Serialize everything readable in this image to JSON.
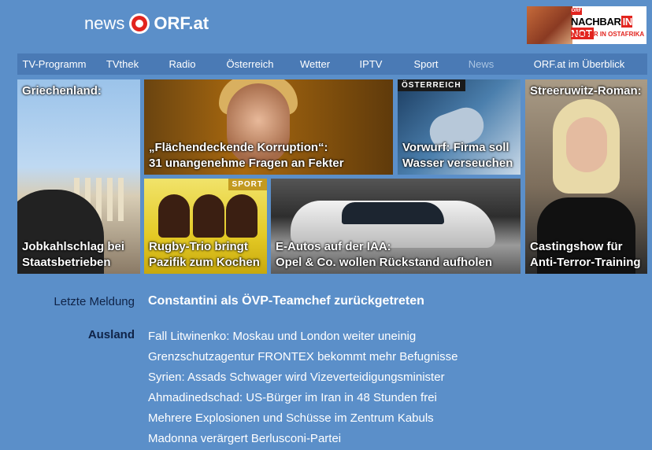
{
  "header": {
    "logo_news": "news",
    "logo_orf": "ORF.at",
    "ad": {
      "tag": "ORF",
      "title_left": "NACHBAR",
      "title_right": "IN NOT",
      "subtitle": "HUNGER IN OSTAFRIKA"
    }
  },
  "nav": {
    "items": [
      {
        "label": "TV-Programm",
        "active": false
      },
      {
        "label": "TVthek",
        "active": false
      },
      {
        "label": "Radio",
        "active": false
      },
      {
        "label": "Österreich",
        "active": false
      },
      {
        "label": "Wetter",
        "active": false
      },
      {
        "label": "IPTV",
        "active": false
      },
      {
        "label": "Sport",
        "active": false
      },
      {
        "label": "News",
        "active": true
      },
      {
        "label": "ORF.at im Überblick",
        "active": false
      }
    ]
  },
  "tiles": {
    "griechenland": {
      "top": "Griechenland:",
      "caption_1": "Jobkahlschlag bei",
      "caption_2": "Staatsbetrieben"
    },
    "fekter": {
      "caption_1": "„Flächendeckende Korruption“:",
      "caption_2": "31 unangenehme Fragen an Fekter"
    },
    "wasser": {
      "tag": "ÖSTERREICH",
      "caption_1": "Vorwurf: Firma soll",
      "caption_2": "Wasser verseuchen"
    },
    "streeruwitz": {
      "top": "Streeruwitz-Roman:",
      "caption_1": "Castingshow für",
      "caption_2": "Anti-Terror-Training"
    },
    "rugby": {
      "tag": "SPORT",
      "caption_1": "Rugby-Trio bringt",
      "caption_2": "Pazifik zum Kochen"
    },
    "eautos": {
      "caption_1": "E-Autos auf der IAA:",
      "caption_2": "Opel & Co. wollen Rückstand aufholen"
    }
  },
  "latest": {
    "label": "Letzte Meldung",
    "headline": "Constantini als ÖVP-Teamchef zurückgetreten"
  },
  "ausland": {
    "label": "Ausland",
    "items": [
      "Fall Litwinenko: Moskau und London weiter uneinig",
      "Grenzschutzagentur FRONTEX bekommt mehr Befugnisse",
      "Syrien: Assads Schwager wird Vizeverteidigungsminister",
      "Ahmadinedschad: US-Bürger im Iran in 48 Stunden frei",
      "Mehrere Explosionen und Schüsse im Zentrum Kabuls",
      "Madonna verärgert Berlusconi-Partei"
    ]
  },
  "colors": {
    "background": "#5b8fc9",
    "nav_background": "#4a7ab5",
    "nav_active": "#a9c4e2",
    "label_text": "#0f2347",
    "accent_red": "#e2241e"
  }
}
